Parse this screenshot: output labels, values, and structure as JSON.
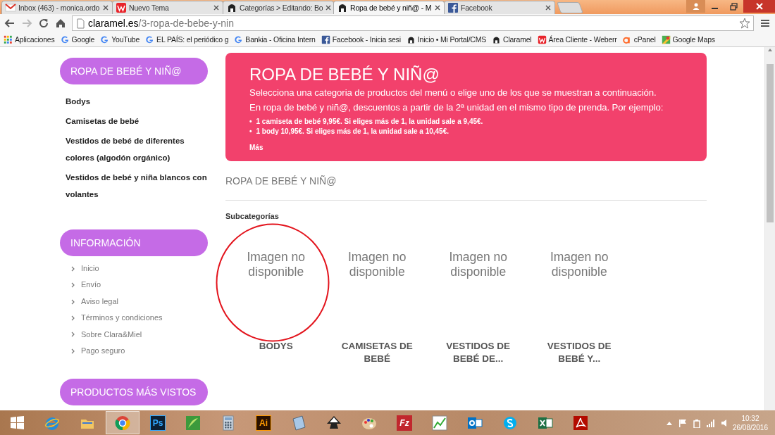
{
  "browser": {
    "tabs": [
      {
        "title": "Inbox (463) - monica.ordo",
        "selected": false
      },
      {
        "title": "Nuevo Tema",
        "selected": false
      },
      {
        "title": "Categorías > Editando: Bo",
        "selected": false
      },
      {
        "title": "Ropa de bebé y niñ@ - M",
        "selected": true
      },
      {
        "title": "Facebook",
        "selected": false
      }
    ],
    "url_host": "claramel.es",
    "url_path": "/3-ropa-de-bebe-y-nin",
    "bookmarks": [
      {
        "label": "Aplicaciones"
      },
      {
        "label": "Google"
      },
      {
        "label": "YouTube"
      },
      {
        "label": "EL PAÍS: el periódico g"
      },
      {
        "label": "Bankia - Oficina Intern"
      },
      {
        "label": "Facebook - Inicia sesi"
      },
      {
        "label": "Inicio • Mi Portal/CMS"
      },
      {
        "label": "Claramel"
      },
      {
        "label": "Área Cliente - Weberr"
      },
      {
        "label": "cPanel"
      },
      {
        "label": "Google Maps"
      }
    ]
  },
  "sidebar": [
    {
      "title": "ROPA DE BEBÉ Y NIÑ@",
      "kind": "categories",
      "items": [
        "Bodys",
        "Camisetas de bebé",
        "Vestidos de bebé de diferentes colores (algodón orgánico)",
        "Vestidos de bebé y niña blancos con volantes"
      ]
    },
    {
      "title": "INFORMACIÓN",
      "kind": "links",
      "items": [
        "Inicio",
        "Envío",
        "Aviso legal",
        "Términos y condiciones",
        "Sobre Clara&Miel",
        "Pago seguro"
      ]
    },
    {
      "title": "PRODUCTOS MÁS VISTOS"
    }
  ],
  "banner": {
    "title": "ROPA DE BEBÉ Y NIÑ@",
    "lines": [
      "Selecciona una categoria de productos del menú o elige uno de los que se muestran a continuación.",
      "En ropa de bebé y niñ@, descuentos a partir de la 2ª unidad en el mismo tipo de prenda. Por ejemplo:"
    ],
    "bullets": [
      {
        "marker": "•",
        "text": "1 camiseta de bebé 9,95€. Si eliges más de 1, la unidad sale a 9,45€."
      },
      {
        "marker": "•",
        "text": "1 body 10,95€. Si eliges más de 1, la unidad sale a 10,45€."
      }
    ],
    "more": "Más"
  },
  "section_title": "ROPA DE BEBÉ Y NIÑ@",
  "subcategories_label": "Subcategorías",
  "subcategories": [
    {
      "image_text": "Imagen no disponible",
      "name": "BODYS",
      "circled": true
    },
    {
      "image_text": "Imagen no disponible",
      "name": "CAMISETAS DE BEBÉ",
      "circled": false
    },
    {
      "image_text": "Imagen no disponible",
      "name": "VESTIDOS DE BEBÉ DE...",
      "circled": false
    },
    {
      "image_text": "Imagen no disponible",
      "name": "VESTIDOS DE BEBÉ Y...",
      "circled": false
    }
  ],
  "taskbar": {
    "apps": [
      {
        "kind": "ie",
        "active": false
      },
      {
        "kind": "folder",
        "active": false
      },
      {
        "kind": "chrome",
        "active": true
      },
      {
        "kind": "letters",
        "text": "Ps",
        "active": false
      },
      {
        "kind": "corel",
        "active": false
      },
      {
        "kind": "calc",
        "active": false
      },
      {
        "kind": "letters",
        "text": "Ai",
        "active": false
      },
      {
        "kind": "notepad",
        "active": false
      },
      {
        "kind": "inkscape",
        "active": false
      },
      {
        "kind": "paint",
        "active": false
      },
      {
        "kind": "letters",
        "text": "Fz",
        "active": false
      },
      {
        "kind": "chart",
        "active": false
      },
      {
        "kind": "outlook",
        "active": false
      },
      {
        "kind": "skype",
        "active": false
      },
      {
        "kind": "excel",
        "active": false
      },
      {
        "kind": "pdf",
        "active": false
      }
    ],
    "time": "10:32",
    "date": "26/08/2016"
  }
}
